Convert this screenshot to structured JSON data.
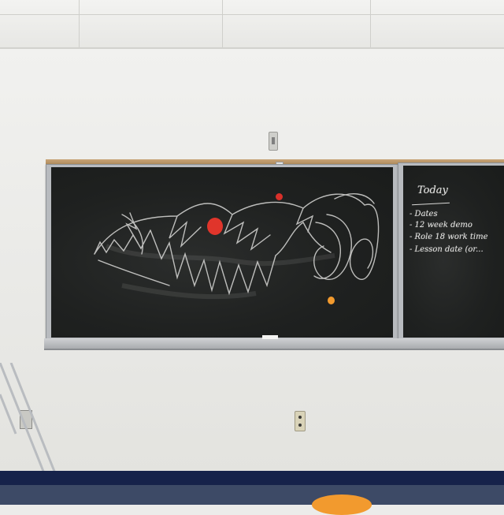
{
  "scene": {
    "colors": {
      "wall": "#ececea",
      "chalkboard": "#1d1f1e",
      "chalk": "#e4e4e2",
      "red_magnet": "#e0352b",
      "orange_magnet": "#f29a2e",
      "baseboard": "#16224a"
    }
  },
  "right_board": {
    "title": "Today",
    "lines": [
      "- Dates",
      "- 12 week demo",
      "- Role 18 work time",
      "- Lesson date (or..."
    ]
  }
}
